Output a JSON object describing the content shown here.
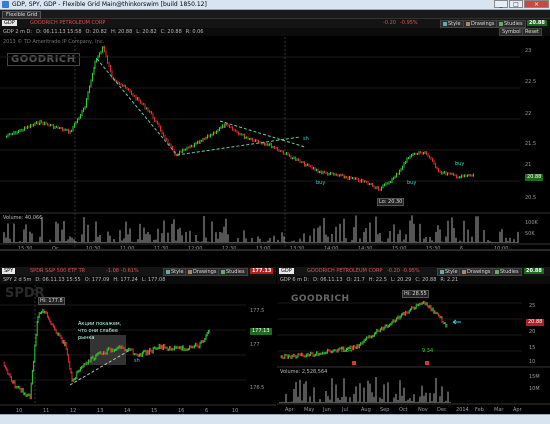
{
  "window": {
    "title": "GDP, SPY, GDP - Flexible Grid Main@thinkorswim [build 1850.12]",
    "minimize": "_",
    "maximize": "□",
    "close": "×"
  },
  "tab": {
    "label": "Flexible Grid"
  },
  "top": {
    "symbol": "GDP",
    "company": "GOODRICH PETROLEUM CORP",
    "change": "-0.20",
    "change_pct": "-0.95%",
    "style": "Style",
    "drawings": "Drawings",
    "studies": "Studies",
    "price": "20.88",
    "symbol_btn": "Symbol",
    "reset_btn": "Reset",
    "info": {
      "line": "GDP 2 m D:",
      "date": "D: 06.11.13 15:58",
      "open": "O: 20.82",
      "high": "H: 20.88",
      "low": "L: 20.82",
      "close": "C: 20.88",
      "rng": "R: 0.06"
    },
    "watermark": "2013 © TD Ameritrade IP Company, Inc.",
    "logo": "GOODRICH",
    "yticks": [
      "23",
      "22.5",
      "22",
      "21.5",
      "21",
      "20.5"
    ],
    "price_tag": "20.88",
    "low_tag": "Lo: 20.30",
    "labels": [
      "sh",
      "buy",
      "buy",
      "buy"
    ],
    "volume_label": "Volume: 40,066",
    "vol_ticks": [
      "100K",
      "50K"
    ],
    "xticks": [
      "15:30",
      "Oc",
      "10:30",
      "11:00",
      "11:30",
      "12:00",
      "12:30",
      "13:00",
      "13:30",
      "14:00",
      "14:30",
      "15:00",
      "15:30",
      "6",
      "10:00"
    ]
  },
  "left": {
    "symbol": "SPY",
    "company": "SPDR S&P 500 ETF TR",
    "change": "-1.08",
    "change_pct": "-0.61%",
    "style": "Style",
    "drawings": "Drawings",
    "studies": "Studies",
    "price": "177.13",
    "info": {
      "line": "SPY 2 d 5m",
      "date": "D: 06.11.13 15:55",
      "open": "O: 177.09",
      "high": "H: 177.24",
      "low": "L: 177.08",
      "close": "C: 177.13",
      "rng": "R: 0.16"
    },
    "watermark": "2013 © TD Ameritrade IP Company, Inc.",
    "logo": "SPDR",
    "hi_tag": "Hi: 177.8",
    "annotation": "Акции покажем, что они слабее рынка",
    "yticks": [
      "177.5",
      "177",
      "176.5"
    ],
    "xticks": [
      "10",
      "11",
      "12",
      "13",
      "14",
      "15",
      "16",
      "6",
      "10"
    ],
    "labels": [
      "sh"
    ]
  },
  "right": {
    "symbol": "GDP",
    "company": "GOODRICH PETROLEUM CORP",
    "change": "-0.20",
    "change_pct": "-0.95%",
    "style": "Style",
    "drawings": "Drawings",
    "studies": "Studies",
    "price": "20.88",
    "info": {
      "line": "GDP 6 m D:",
      "date": "D: 06.11.13",
      "open": "O: 21.7",
      "high": "H: 22.5",
      "low": "L: 20.29",
      "close": "C: 20.88",
      "rng": "R: 2.21"
    },
    "watermark": "2013 © TD Ameritrade IP Company, Inc.",
    "logo": "GOODRICH",
    "hi_tag": "Hi: 28.55",
    "markers": [
      "8.64",
      "9.34"
    ],
    "yticks": [
      "25",
      "20",
      "15",
      "10"
    ],
    "volume_label": "Volume: 2,528,564",
    "vol_ticks": [
      "15M",
      "10M"
    ],
    "xticks": [
      "Apr",
      "May",
      "Jun",
      "Jul",
      "Aug",
      "Sep",
      "Oct",
      "Nov",
      "Dec",
      "2014",
      "Feb",
      "Mar",
      "Apr"
    ]
  },
  "colors": {
    "up": "#2fd22f",
    "down": "#e03030",
    "trend": "#5fcfa0",
    "price_green": "#1e6b1e",
    "price_red": "#b32020"
  }
}
